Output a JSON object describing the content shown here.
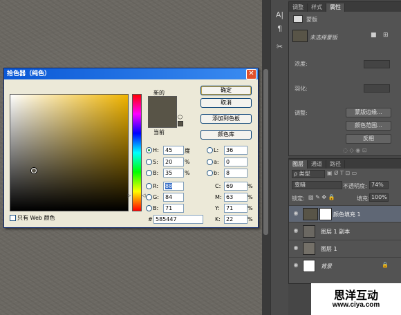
{
  "dialog": {
    "title": "拾色器（纯色）",
    "close_label": "✕",
    "new_label": "新的",
    "current_label": "当前",
    "new_color": "#585447",
    "current_color": "#585447",
    "buttons": {
      "ok": "确定",
      "cancel": "取消",
      "add_swatch": "添加到色板",
      "color_libraries": "颜色库"
    },
    "hsb": [
      {
        "key": "H:",
        "value": "45",
        "unit": "度"
      },
      {
        "key": "S:",
        "value": "20",
        "unit": "%"
      },
      {
        "key": "B:",
        "value": "35",
        "unit": "%"
      }
    ],
    "rgb": [
      {
        "key": "R:",
        "value": "88"
      },
      {
        "key": "G:",
        "value": "84"
      },
      {
        "key": "B:",
        "value": "71"
      }
    ],
    "lab": [
      {
        "key": "L:",
        "value": "36"
      },
      {
        "key": "a:",
        "value": "0"
      },
      {
        "key": "b:",
        "value": "8"
      }
    ],
    "cmyk": [
      {
        "key": "C:",
        "value": "69",
        "unit": "%"
      },
      {
        "key": "M:",
        "value": "63",
        "unit": "%"
      },
      {
        "key": "Y:",
        "value": "71",
        "unit": "%"
      },
      {
        "key": "K:",
        "value": "22",
        "unit": "%"
      }
    ],
    "hex_label": "#",
    "hex_value": "585447",
    "web_only_label": "只有 Web 颜色",
    "hue_base": "#f0b400"
  },
  "props_panel": {
    "tabs": [
      "调整",
      "样式",
      "属性"
    ],
    "active_tab": "属性",
    "mask_label": "蒙版",
    "mask_name": "未选择蒙版",
    "density_label": "浓度:",
    "feather_label": "羽化:",
    "adjust_label": "调整:",
    "buttons": [
      "蒙版边缘...",
      "颜色范围...",
      "反相"
    ]
  },
  "layers_panel": {
    "tabs": [
      "图层",
      "通道",
      "路径"
    ],
    "active_tab": "图层",
    "filter_label": "ρ 类型",
    "blend_mode": "变暗",
    "opacity_label": "不透明度:",
    "opacity_value": "74%",
    "lock_label": "锁定:",
    "fill_label": "填充:",
    "fill_value": "100%",
    "layers": [
      {
        "name": "颜色填充 1",
        "selected": true
      },
      {
        "name": "图层 1 副本",
        "selected": false
      },
      {
        "name": "图层 1",
        "selected": false
      },
      {
        "name": "背景",
        "selected": false
      }
    ]
  },
  "watermark": {
    "title": "思洋互动",
    "url": "www.ciya.com"
  }
}
